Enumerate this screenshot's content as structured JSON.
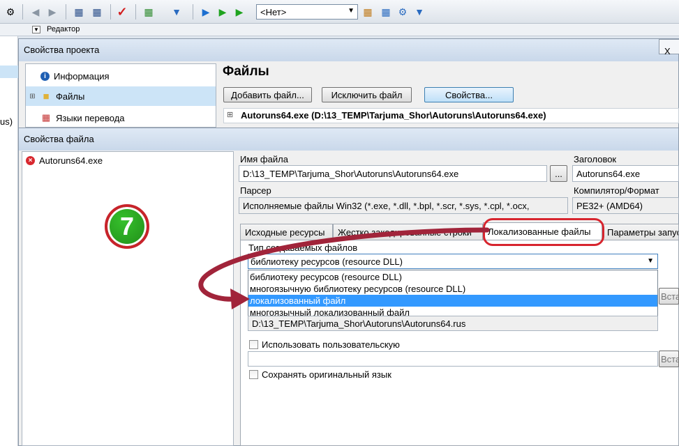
{
  "toolbar": {
    "combo_value": "<Нет>",
    "sub_label": "Редактор"
  },
  "left_fragment": "us)",
  "project_dialog": {
    "title": "Свойства проекта",
    "close": "X",
    "tree": [
      {
        "label": "Информация",
        "icon": "info-icon"
      },
      {
        "label": "Файлы",
        "icon": "folder-icon",
        "selected": true
      },
      {
        "label": "Языки перевода",
        "icon": "languages-icon"
      }
    ],
    "header": "Файлы",
    "buttons": {
      "add": "Добавить файл...",
      "exclude": "Исключить файл",
      "properties": "Свойства..."
    },
    "file_node": "Autoruns64.exe (D:\\13_TEMP\\Tarjuma_Shor\\Autoruns\\Autoruns64.exe)"
  },
  "file_dialog": {
    "title": "Свойства файла",
    "list_item": "Autoruns64.exe",
    "badge_number": "7",
    "filename_label": "Имя файла",
    "filename_value": "D:\\13_TEMP\\Tarjuma_Shor\\Autoruns\\Autoruns64.exe",
    "browse_label": "...",
    "header_label": "Заголовок",
    "header_value": "Autoruns64.exe",
    "parser_label": "Парсер",
    "parser_value": "Исполняемые файлы Win32 (*.exe, *.dll, *.bpl, *.scr, *.sys, *.cpl, *.ocx,",
    "compiler_label": "Компилятор/Формат",
    "compiler_value": "PE32+ (AMD64)",
    "tabs": [
      "Исходные ресурсы",
      "Жестко закодированные строки",
      "Локализованные файлы",
      "Параметры запуска"
    ],
    "type_label": "Тип создаваемых файлов",
    "type_value": "библиотеку ресурсов (resource DLL)",
    "type_options": [
      "библиотеку ресурсов (resource DLL)",
      "многоязычную библиотеку ресурсов (resource DLL)",
      "локализованный файл",
      "многоязычный локализованный файл"
    ],
    "selected_option_index": 2,
    "insert_label_1": "Вста",
    "output_path": "D:\\13_TEMP\\Tarjuma_Shor\\Autoruns\\Autoruns64.rus",
    "use_custom_label": "Использовать пользовательскую",
    "insert_label_2": "Вста",
    "keep_original_label": "Сохранять оригинальный язык"
  },
  "colors": {
    "highlight": "#d7252e",
    "selection": "#3399ff",
    "badge_green": "#2aa421",
    "arrow": "#a1243a"
  }
}
